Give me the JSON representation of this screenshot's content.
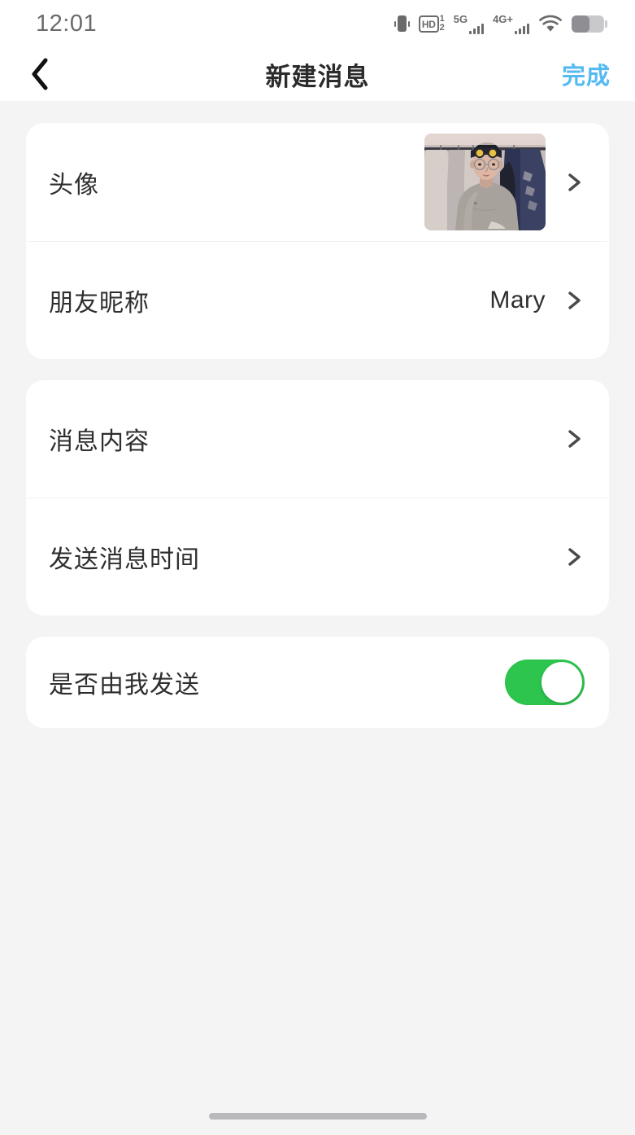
{
  "status_bar": {
    "time": "12:01",
    "icons": [
      {
        "name": "vibrate-icon",
        "label": ""
      },
      {
        "name": "hd-voice-icon",
        "label": "HD",
        "numerator": "1",
        "denominator": "2"
      },
      {
        "name": "signal-5g-icon",
        "label": "5G",
        "bars": 4
      },
      {
        "name": "signal-4g-plus-icon",
        "label": "4G+",
        "bars": 4
      },
      {
        "name": "wifi-icon",
        "label": ""
      },
      {
        "name": "battery-icon",
        "label": "",
        "level_percent": 55
      }
    ]
  },
  "nav_bar": {
    "back_label": "‹",
    "title": "新建消息",
    "action_label": "完成",
    "action_color": "#56baf2"
  },
  "sections": [
    {
      "name": "profile-section",
      "rows": [
        {
          "name": "avatar-row",
          "label": "头像",
          "type": "avatar",
          "value": "",
          "chevron": true
        },
        {
          "name": "nickname-row",
          "label": "朋友昵称",
          "type": "value",
          "value": "Mary",
          "chevron": true
        }
      ]
    },
    {
      "name": "message-section",
      "rows": [
        {
          "name": "message-content-row",
          "label": "消息内容",
          "type": "plain",
          "value": "",
          "chevron": true
        },
        {
          "name": "send-time-row",
          "label": "发送消息时间",
          "type": "plain",
          "value": "",
          "chevron": true
        }
      ]
    },
    {
      "name": "sender-section",
      "rows": [
        {
          "name": "sent-by-me-row",
          "label": "是否由我发送",
          "type": "switch",
          "value": "",
          "switch_on": true
        }
      ]
    }
  ],
  "theme": {
    "page_background": "#f4f4f5",
    "card_background": "#ffffff",
    "label_color": "#2e2e2e",
    "accent_blue": "#56baf2",
    "switch_on_color": "#2dc54e",
    "divider_color": "#f0f0f1"
  }
}
